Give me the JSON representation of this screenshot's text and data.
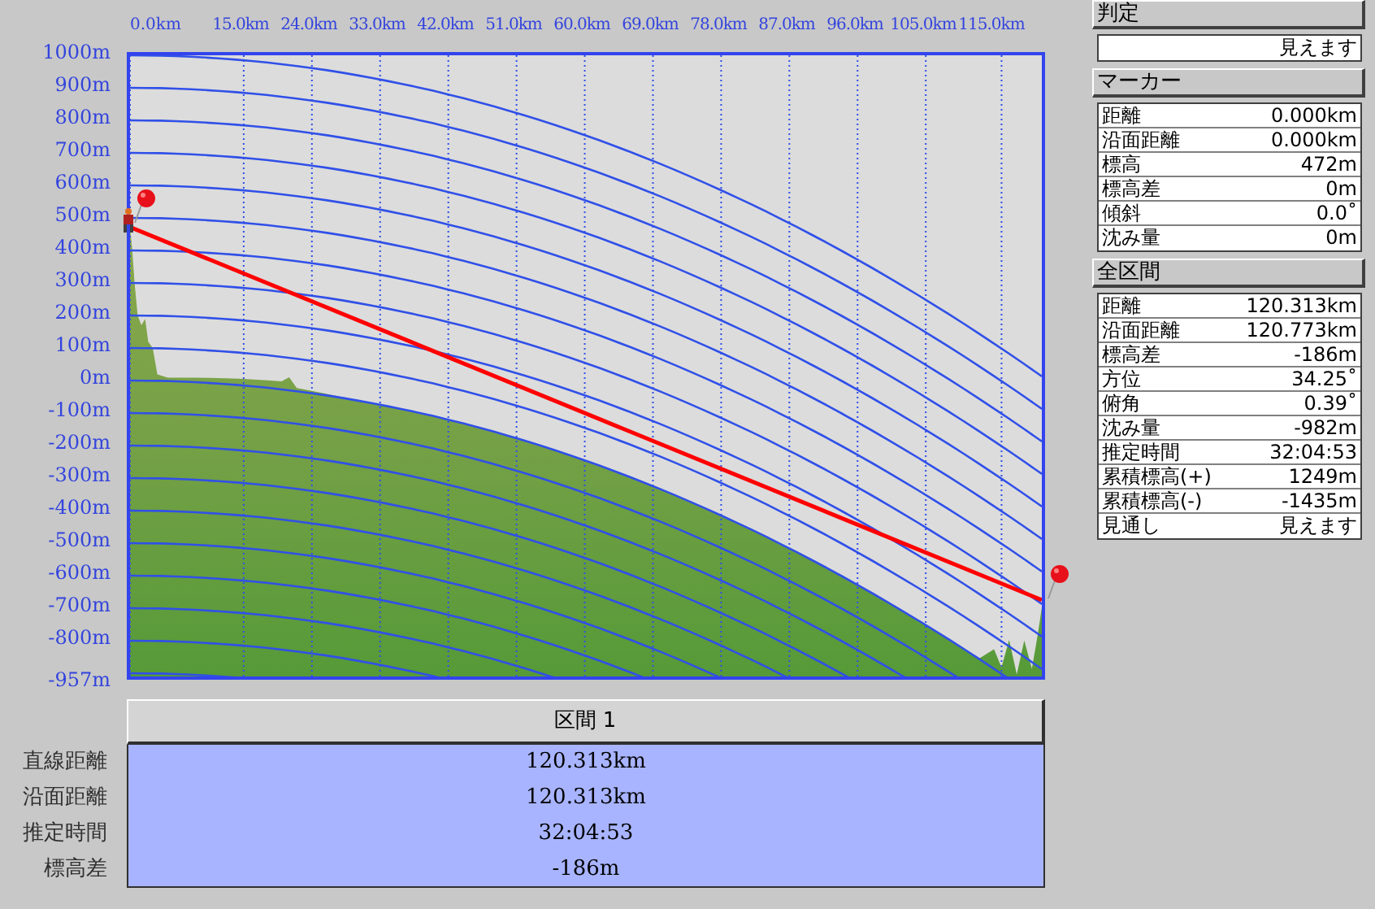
{
  "x_axis_labels": [
    "0.0km",
    "15.0km",
    "24.0km",
    "33.0km",
    "42.0km",
    "51.0km",
    "60.0km",
    "69.0km",
    "78.0km",
    "87.0km",
    "96.0km",
    "105.0km",
    "115.0km"
  ],
  "y_axis_labels": [
    "1000m",
    "900m",
    "800m",
    "700m",
    "600m",
    "500m",
    "400m",
    "300m",
    "200m",
    "100m",
    "0m",
    "-100m",
    "-200m",
    "-300m",
    "-400m",
    "-500m",
    "-600m",
    "-700m",
    "-800m",
    "-957m"
  ],
  "interval_table": {
    "header": "区間 1",
    "rows": [
      {
        "label": "直線距離",
        "value": "120.313km"
      },
      {
        "label": "沿面距離",
        "value": "120.313km"
      },
      {
        "label": "推定時間",
        "value": "32:04:53"
      },
      {
        "label": "標高差",
        "value": "-186m"
      }
    ]
  },
  "judgement": {
    "title": "判定",
    "value": "見えます"
  },
  "marker": {
    "title": "マーカー",
    "rows": [
      {
        "label": "距離",
        "value": "0.000km"
      },
      {
        "label": "沿面距離",
        "value": "0.000km"
      },
      {
        "label": "標高",
        "value": "472m"
      },
      {
        "label": "標高差",
        "value": "0m"
      },
      {
        "label": "傾斜",
        "value": "0.0˚"
      },
      {
        "label": "沈み量",
        "value": "0m"
      }
    ]
  },
  "total": {
    "title": "全区間",
    "rows": [
      {
        "label": "距離",
        "value": "120.313km"
      },
      {
        "label": "沿面距離",
        "value": "120.773km"
      },
      {
        "label": "標高差",
        "value": "-186m"
      },
      {
        "label": "方位",
        "value": "34.25˚"
      },
      {
        "label": "俯角",
        "value": "0.39˚"
      },
      {
        "label": "沈み量",
        "value": "-982m"
      },
      {
        "label": "推定時間",
        "value": "32:04:53"
      },
      {
        "label": "累積標高(+)",
        "value": "1249m"
      },
      {
        "label": "累積標高(-)",
        "value": "-1435m"
      },
      {
        "label": "見通し",
        "value": "見えます"
      }
    ]
  }
}
